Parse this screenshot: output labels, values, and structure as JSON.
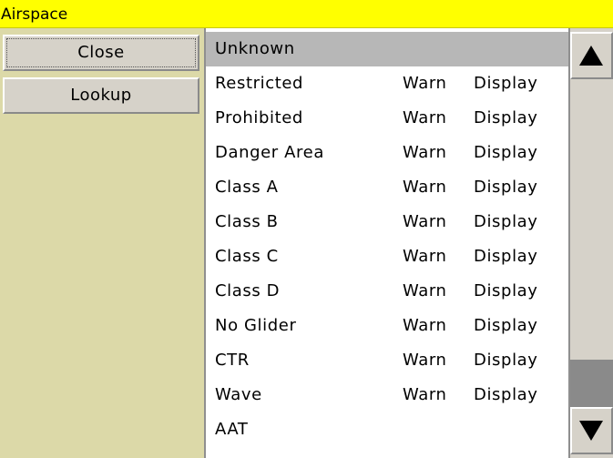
{
  "window": {
    "title": "Airspace"
  },
  "buttons": {
    "close": "Close",
    "lookup": "Lookup"
  },
  "colors": {
    "title_bar": "#ffff00",
    "left_panel": "#dcd9a8",
    "selected_row": "#b7b7b7",
    "button_face": "#d6d2c9",
    "scroll_thumb": "#8a8a8a"
  },
  "list": {
    "selected_index": 0,
    "rows": [
      {
        "name": "Unknown",
        "warn": "",
        "display": ""
      },
      {
        "name": "Restricted",
        "warn": "Warn",
        "display": "Display"
      },
      {
        "name": "Prohibited",
        "warn": "Warn",
        "display": "Display"
      },
      {
        "name": "Danger Area",
        "warn": "Warn",
        "display": "Display"
      },
      {
        "name": "Class A",
        "warn": "Warn",
        "display": "Display"
      },
      {
        "name": "Class B",
        "warn": "Warn",
        "display": "Display"
      },
      {
        "name": "Class C",
        "warn": "Warn",
        "display": "Display"
      },
      {
        "name": "Class D",
        "warn": "Warn",
        "display": "Display"
      },
      {
        "name": "No Glider",
        "warn": "Warn",
        "display": "Display"
      },
      {
        "name": "CTR",
        "warn": "Warn",
        "display": "Display"
      },
      {
        "name": "Wave",
        "warn": "Warn",
        "display": "Display"
      },
      {
        "name": "AAT",
        "warn": "",
        "display": ""
      }
    ]
  },
  "scrollbar": {
    "up_icon": "triangle-up-icon",
    "down_icon": "triangle-down-icon"
  }
}
